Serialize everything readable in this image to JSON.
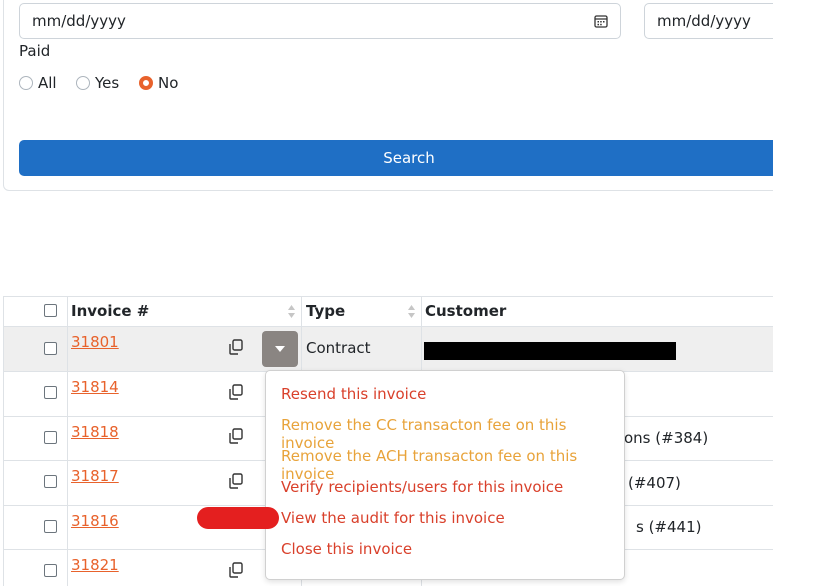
{
  "filters": {
    "date_from_placeholder": "mm/dd/yyyy",
    "date_to_placeholder": "mm/dd/yyyy",
    "paid_label": "Paid",
    "paid_options": [
      "All",
      "Yes",
      "No"
    ],
    "paid_selected": "No",
    "search_label": "Search"
  },
  "table": {
    "columns": [
      "Invoice #",
      "Type",
      "Customer"
    ],
    "rows": [
      {
        "invoice": "31801",
        "type": "Contract",
        "customer": ""
      },
      {
        "invoice": "31814",
        "type": "",
        "customer": ""
      },
      {
        "invoice": "31818",
        "type": "",
        "customer": "ons (#384)"
      },
      {
        "invoice": "31817",
        "type": "",
        "customer": "(#407)"
      },
      {
        "invoice": "31816",
        "type": "",
        "customer": "s (#441)"
      },
      {
        "invoice": "31821",
        "type": "",
        "customer": ""
      }
    ]
  },
  "menu": {
    "items": [
      "Resend this invoice",
      "Remove the CC transacton fee on this invoice",
      "Remove the ACH transacton fee on this invoice",
      "Verify recipients/users for this invoice",
      "View the audit for this invoice",
      "Close this invoice"
    ]
  },
  "colors": {
    "accent": "#e8622c",
    "primary": "#1f6fc5",
    "menu_red": "#d9402b",
    "menu_gold": "#e8a33a"
  }
}
